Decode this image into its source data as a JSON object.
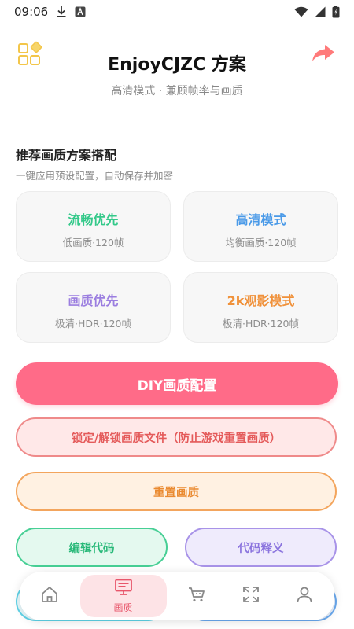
{
  "status_bar": {
    "time": "09:06"
  },
  "header": {
    "title": "EnjoyCJZC 方案",
    "subtitle": "高清模式 · 兼顾帧率与画质"
  },
  "section": {
    "title": "推荐画质方案搭配",
    "subtitle": "一键应用预设配置，自动保存并加密"
  },
  "presets": [
    {
      "title": "流畅优先",
      "desc": "低画质·120帧",
      "color": "#34c98a"
    },
    {
      "title": "高清模式",
      "desc": "均衡画质·120帧",
      "color": "#4a9ae8"
    },
    {
      "title": "画质优先",
      "desc": "极清·HDR·120帧",
      "color": "#9b7ee0"
    },
    {
      "title": "2k观影模式",
      "desc": "极清·HDR·120帧",
      "color": "#f0913a"
    }
  ],
  "buttons": {
    "diy": "DIY画质配置",
    "lock": "锁定/解锁画质文件（防止游戏重置画质）",
    "reset": "重置画质",
    "edit_code": "编辑代码",
    "code_explain": "代码释义"
  },
  "nav": {
    "active_label": "画质",
    "items": [
      "home-icon",
      "display-icon",
      "cart-icon",
      "expand-icon",
      "user-icon"
    ]
  },
  "colors": {
    "accent": "#ff6b88",
    "share": "#ff7a7a",
    "grid_icon": "#f3c64a"
  }
}
